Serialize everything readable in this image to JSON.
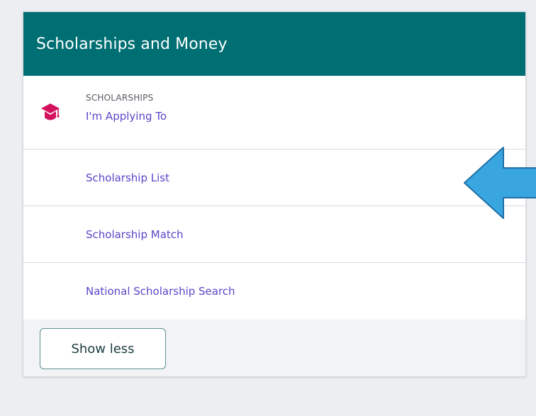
{
  "card": {
    "title": "Scholarships and Money",
    "section_label": "SCHOLARSHIPS",
    "items": [
      {
        "label": "I'm Applying To"
      },
      {
        "label": "Scholarship List"
      },
      {
        "label": "Scholarship Match"
      },
      {
        "label": "National Scholarship Search"
      }
    ],
    "show_less_label": "Show less"
  },
  "icons": {
    "section": "graduation-cap-icon",
    "annotation": "left-arrow-icon"
  },
  "colors": {
    "header_bg": "#006f73",
    "link": "#5b45c9",
    "icon": "#d3115d",
    "annotation_arrow": "#39a6e0",
    "page_bg": "#eceef1"
  }
}
